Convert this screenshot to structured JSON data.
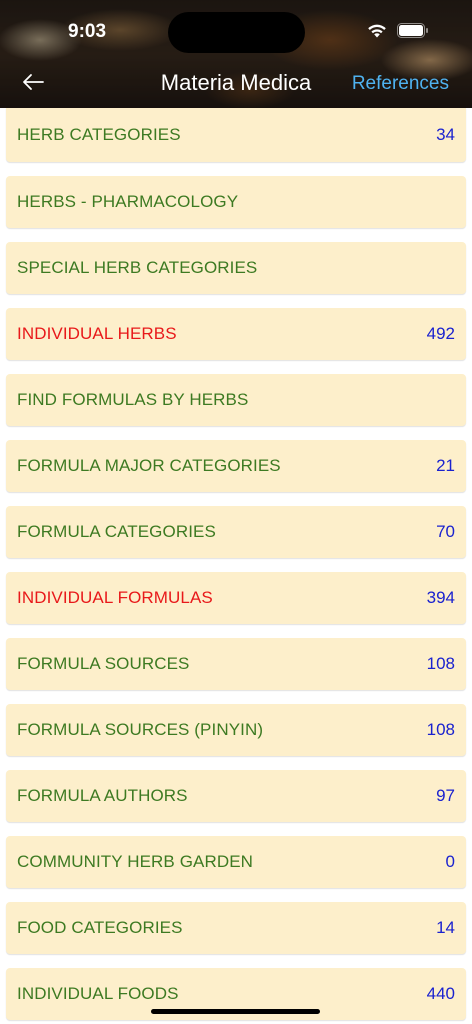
{
  "status": {
    "time": "9:03"
  },
  "nav": {
    "back_label": "←",
    "title": "Materia Medica",
    "references_label": "References"
  },
  "items": [
    {
      "label": "HERB CATEGORIES",
      "count": "34",
      "highlight": false
    },
    {
      "label": "HERBS - PHARMACOLOGY",
      "count": "",
      "highlight": false
    },
    {
      "label": "SPECIAL HERB CATEGORIES",
      "count": "",
      "highlight": false
    },
    {
      "label": "INDIVIDUAL HERBS",
      "count": "492",
      "highlight": true
    },
    {
      "label": "FIND FORMULAS BY HERBS",
      "count": "",
      "highlight": false
    },
    {
      "label": "FORMULA MAJOR CATEGORIES",
      "count": "21",
      "highlight": false
    },
    {
      "label": "FORMULA CATEGORIES",
      "count": "70",
      "highlight": false
    },
    {
      "label": "INDIVIDUAL FORMULAS",
      "count": "394",
      "highlight": true
    },
    {
      "label": "FORMULA SOURCES",
      "count": "108",
      "highlight": false
    },
    {
      "label": "FORMULA SOURCES (PINYIN)",
      "count": "108",
      "highlight": false
    },
    {
      "label": "FORMULA AUTHORS",
      "count": "97",
      "highlight": false
    },
    {
      "label": "COMMUNITY HERB GARDEN",
      "count": "0",
      "highlight": false
    },
    {
      "label": "FOOD CATEGORIES",
      "count": "14",
      "highlight": false
    },
    {
      "label": "INDIVIDUAL FOODS",
      "count": "440",
      "highlight": false
    }
  ],
  "colors": {
    "row_bg": "#fdefcb",
    "label_green": "#3d7a22",
    "label_red": "#e8191a",
    "count_blue": "#1a22cf",
    "link_blue": "#4fb2f0"
  }
}
